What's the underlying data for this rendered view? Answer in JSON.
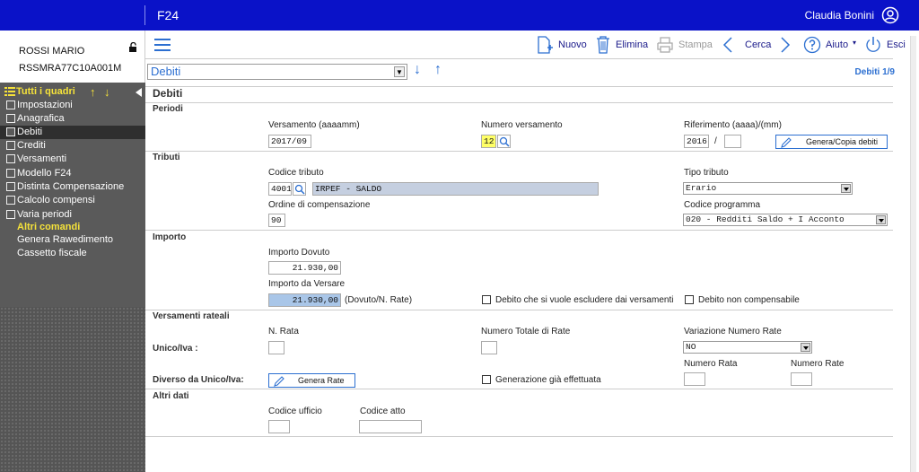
{
  "app": {
    "title": "F24",
    "user_name": "Claudia Bonini"
  },
  "user": {
    "name": "ROSSI MARIO",
    "fiscal_code": "RSSMRA77C10A001M"
  },
  "sidebar": {
    "header": "Tutti i quadri",
    "items": [
      {
        "label": "Impostazioni"
      },
      {
        "label": "Anagrafica"
      },
      {
        "label": "Debiti"
      },
      {
        "label": "Crediti"
      },
      {
        "label": "Versamenti"
      },
      {
        "label": "Modello F24"
      },
      {
        "label": "Distinta Compensazione"
      },
      {
        "label": "Calcolo compensi"
      },
      {
        "label": "Varia periodi"
      }
    ],
    "other_header": "Altri comandi",
    "other_items": [
      {
        "label": "Genera Rawedimento"
      },
      {
        "label": "Cassetto fiscale"
      }
    ]
  },
  "toolbar": {
    "new": "Nuovo",
    "delete": "Elimina",
    "print": "Stampa",
    "search": "Cerca",
    "help": "Aiuto",
    "exit": "Esci"
  },
  "section_select": {
    "value": "Debiti"
  },
  "page_counter": "Debiti 1/9",
  "page_title": "Debiti",
  "periodi": {
    "title": "Periodi",
    "versamento_label": "Versamento (aaaamm)",
    "versamento_value": "2017/09",
    "numero_label": "Numero versamento",
    "numero_value": "12",
    "riferimento_label": "Riferimento (aaaa)/(mm)",
    "riferimento_year": "2016",
    "riferimento_sep": "/",
    "riferimento_month": "",
    "genera_copia_label": "Genera/Copia debiti"
  },
  "tributi": {
    "title": "Tributi",
    "codice_label": "Codice tributo",
    "codice_value": "4001",
    "codice_desc": "IRPEF  - SALDO",
    "tipo_label": "Tipo tributo",
    "tipo_value": "Erario",
    "ordine_label": "Ordine di compensazione",
    "ordine_value": "90",
    "programma_label": "Codice programma",
    "programma_value": "020 - Redditi Saldo + I Acconto"
  },
  "importo": {
    "title": "Importo",
    "dovuto_label": "Importo Dovuto",
    "dovuto_value": "21.930,00",
    "versare_label": "Importo da Versare",
    "versare_value": "21.930,00",
    "versare_note": "(Dovuto/N. Rate)",
    "escludere_label": "Debito che si vuole escludere dai versamenti",
    "non_compensabile_label": "Debito non compensabile"
  },
  "rateali": {
    "title": "Versamenti rateali",
    "n_rata_label": "N. Rata",
    "totale_rate_label": "Numero Totale di Rate",
    "variazione_label": "Variazione Numero Rate",
    "unico_label": "Unico/Iva :",
    "variazione_value": "NO",
    "diverso_label": "Diverso da Unico/Iva:",
    "genera_rate_label": "Genera Rate",
    "generazione_label": "Generazione già effettuata",
    "numero_rata_label": "Numero Rata",
    "numero_rate_label": "Numero Rate"
  },
  "altri": {
    "title": "Altri dati",
    "ufficio_label": "Codice ufficio",
    "atto_label": "Codice atto"
  }
}
